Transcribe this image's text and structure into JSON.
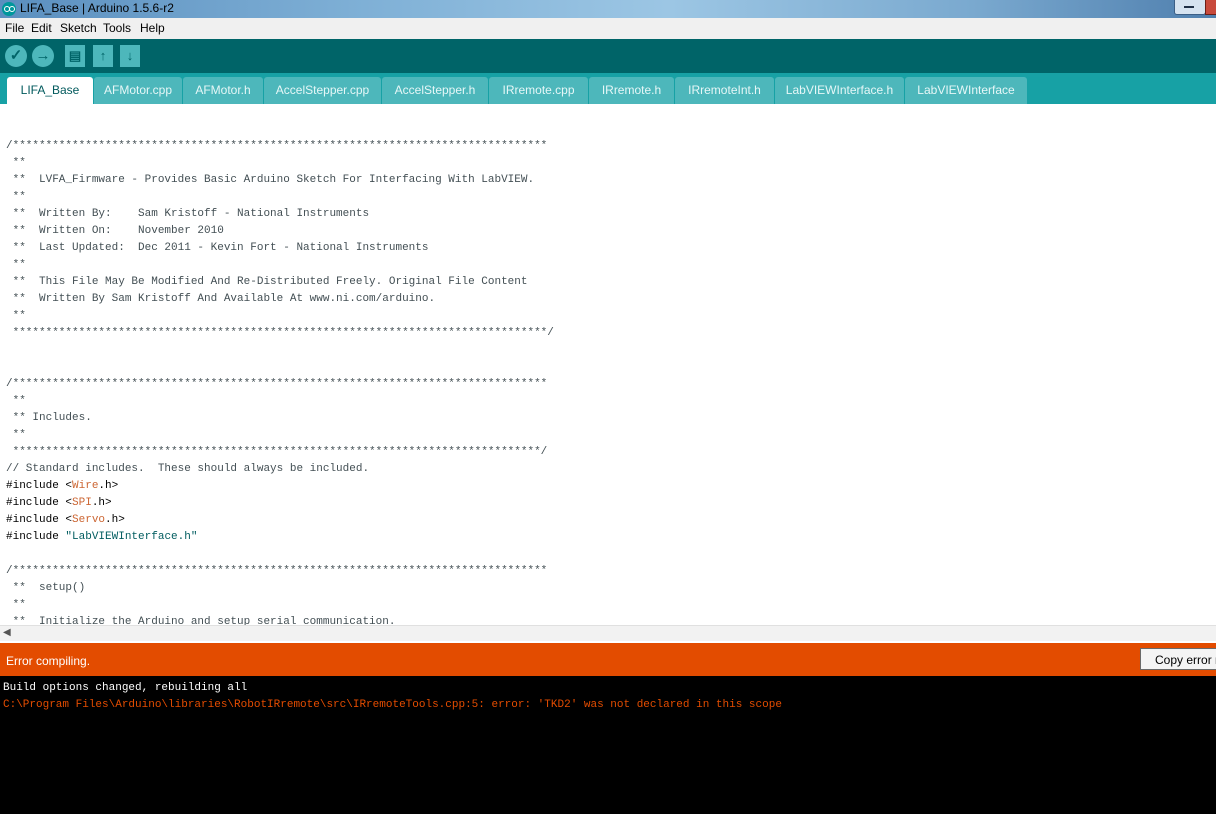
{
  "window": {
    "title": "LIFA_Base | Arduino 1.5.6-r2"
  },
  "menu": [
    "File",
    "Edit",
    "Sketch",
    "Tools",
    "Help"
  ],
  "toolbar": {
    "verify": "✓",
    "upload": "→",
    "new": "▤",
    "open": "↑",
    "save": "↓"
  },
  "tabs": [
    "LIFA_Base",
    "AFMotor.cpp",
    "AFMotor.h",
    "AccelStepper.cpp",
    "AccelStepper.h",
    "IRremote.cpp",
    "IRremote.h",
    "IRremoteInt.h",
    "LabVIEWInterface.h",
    "LabVIEWInterface"
  ],
  "code": {
    "l01": "/*********************************************************************************",
    "l02": " **",
    "l03": " **  LVFA_Firmware - Provides Basic Arduino Sketch For Interfacing With LabVIEW.",
    "l04": " **",
    "l05": " **  Written By:    Sam Kristoff - National Instruments",
    "l06": " **  Written On:    November 2010",
    "l07": " **  Last Updated:  Dec 2011 - Kevin Fort - National Instruments",
    "l08": " **",
    "l09": " **  This File May Be Modified And Re-Distributed Freely. Original File Content",
    "l10": " **  Written By Sam Kristoff And Available At www.ni.com/arduino.",
    "l11": " **",
    "l12": " *********************************************************************************/",
    "l13": "/*********************************************************************************",
    "l14": " **",
    "l15": " ** Includes.",
    "l16": " **",
    "l17": " ********************************************************************************/",
    "l18": "// Standard includes.  These should always be included.",
    "inc1": {
      "kw": "#include <",
      "lib": "Wire",
      "rest": ".h>"
    },
    "inc2": {
      "kw": "#include <",
      "lib": "SPI",
      "rest": ".h>"
    },
    "inc3": {
      "kw": "#include <",
      "lib": "Servo",
      "rest": ".h>"
    },
    "inc4": {
      "kw": "#include ",
      "str": "\"LabVIEWInterface.h\""
    },
    "l23": "/*********************************************************************************",
    "l24": " **  setup()",
    "l25": " **",
    "l26": " **  Initialize the Arduino and setup serial communication."
  },
  "status": {
    "message": "Error compiling.",
    "copy_button": "Copy error messages",
    "color": "#e34c00"
  },
  "console": {
    "line1": "Build options changed, rebuilding all",
    "line2": "C:\\Program Files\\Arduino\\libraries\\RobotIRremote\\src\\IRremoteTools.cpp:5: error: 'TKD2' was not declared in this scope"
  },
  "colors": {
    "toolbar": "#006468",
    "tabbar": "#17a1a5",
    "tab": "#4db7bb"
  }
}
